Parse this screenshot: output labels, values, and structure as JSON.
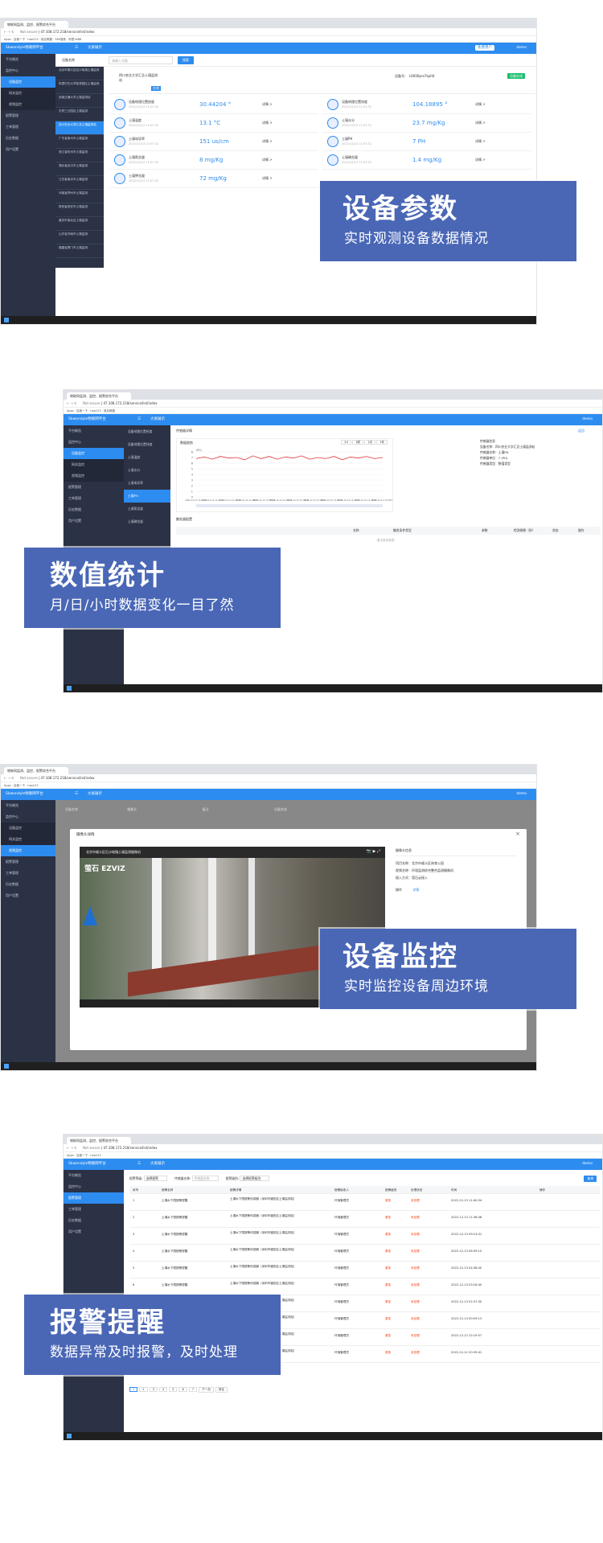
{
  "browser": {
    "url": "47.108.172.218/service/list/index",
    "not_secure": "Not secure",
    "tab_title": "物联网监测、监控、报警综合平台",
    "bookmarks": [
      "Apps",
      "百度一下",
      "hao123",
      "用友畅捷",
      "360搜索",
      "阿里1688",
      "京东商城",
      "Win7系统",
      "Win7系统",
      "搜狐视频",
      "微博网",
      "其他"
    ]
  },
  "app": {
    "logo": "Skwendyle物联网平台",
    "menu_title": "大屏展示",
    "user": "demo",
    "badge": "免费用户"
  },
  "sidebar": {
    "items": [
      {
        "label": "平台概览"
      },
      {
        "label": "监控中心"
      },
      {
        "label": "设备监控"
      },
      {
        "label": "网关监控"
      },
      {
        "label": "视频监控"
      },
      {
        "label": "报警管理"
      },
      {
        "label": "工单管理"
      },
      {
        "label": "历史数据"
      },
      {
        "label": "用户设置"
      }
    ]
  },
  "panel1": {
    "search_label": "设备名称",
    "search_placeholder": "请输入设备",
    "search_btn": "搜索",
    "devices": [
      "北京市顺义区后沙峪镇土壤监测",
      "阿里巴巴大学智慧园区土壤监测",
      "西南交通大学土壤监测站",
      "天府三元园区土壤监测",
      "四川农业大学汇总土壤监测站",
      "广东省惠州市土壤监测",
      "浙江省杭州市土壤监测",
      "湖北省武汉市土壤监测",
      "江苏省南京市土壤监测",
      "河南省郑州市土壤监测",
      "陕西省西安市土壤监测",
      "重庆市渝北区土壤监测",
      "山东省济南市土壤监测",
      "福建省厦门市土壤监测"
    ],
    "header": {
      "name": "四川农业大学汇总土壤监测站",
      "status": "在线",
      "serial_label": "设备号:",
      "serial": "L6000pro7kph6",
      "online_btn": "设备在线"
    },
    "metrics": [
      {
        "name": "设备地理位置经度",
        "time": "2022/12/13 11:07:32",
        "value": "30.44204 °",
        "more": "详情 >"
      },
      {
        "name": "设备地理位置纬度",
        "time": "2022/12/13 11:07:32",
        "value": "104.18895 °",
        "more": "详情 >"
      },
      {
        "name": "土壤温度",
        "time": "2022/12/13 11:07:32",
        "value": "13.1 °C",
        "more": "详情 >"
      },
      {
        "name": "土壤水分",
        "time": "2022/12/13 11:07:32",
        "value": "23.7 mg/Kg",
        "more": "详情 >"
      },
      {
        "name": "土壤电导率",
        "time": "2022/12/13 11:07:32",
        "value": "151 us/cm",
        "more": "详情 >"
      },
      {
        "name": "土壤PH",
        "time": "2022/12/13 11:07:32",
        "value": "7 PH",
        "more": "详情 >"
      },
      {
        "name": "土壤氮含量",
        "time": "2022/12/13 11:07:32",
        "value": "8 mg/Kg",
        "more": "详情 >"
      },
      {
        "name": "土壤磷含量",
        "time": "2022/12/13 11:07:32",
        "value": "1.4 mg/Kg",
        "more": "详情 >"
      },
      {
        "name": "土壤钾含量",
        "time": "2022/12/13 11:07:32",
        "value": "72 mg/Kg",
        "more": "详情 >"
      }
    ]
  },
  "panel2": {
    "title": "传感器详情",
    "back": "返回",
    "tabs": [
      "设备地理位置经度",
      "设备地理位置纬度",
      "土壤温度",
      "土壤水分",
      "土壤电导率",
      "土壤PH",
      "土壤氮含量",
      "土壤磷含量"
    ],
    "chart_title": "数据趋势",
    "ranges": [
      "24",
      "1周",
      "1月",
      "1年"
    ],
    "info_title": "传感器信息",
    "info": [
      "设备名称：四川农业大学汇总土壤监测站",
      "传感器名称：土壤PH",
      "传感器单位：7 (PH)",
      "传感器类型：数值类型"
    ],
    "section2": "触发器配置",
    "cols": [
      "名称",
      "触发条件类型",
      "参数",
      "检测周期（秒）",
      "状态",
      "操作"
    ],
    "empty": "暂无更多数据"
  },
  "chart_data": {
    "type": "line",
    "ylabel": "(PH)",
    "ylim": [
      0,
      8
    ],
    "yticks": [
      "0",
      "1",
      "2",
      "3",
      "4",
      "5",
      "6",
      "7",
      "8"
    ],
    "x": [
      "2022-12-13 11:07:32",
      "2022-12-13 11:17:31",
      "2022-12-13 11:37:32",
      "2022-12-13 11:48:27",
      "2022-12-13 12:07:31",
      "2022-12-13 12:17:31",
      "2022-12-13 12:37:32",
      "2022-12-13 12:48:27",
      "2022-12-13 13:07:31",
      "2022-12-13 13:17:31",
      "2022-12-13 13:37:32",
      "2022-12-13 13:48:27"
    ],
    "series": [
      {
        "values": [
          6.8,
          7.1,
          6.7,
          7.2,
          6.9,
          7.0,
          6.6,
          7.3,
          6.8,
          7.2,
          6.7,
          7.1,
          6.9,
          7.3,
          6.7,
          7.0,
          6.8,
          7.2,
          6.6,
          7.1,
          6.9,
          7.2,
          6.8,
          7.0
        ]
      }
    ]
  },
  "panel3": {
    "filters": [
      "设备名称",
      "摄像头",
      "备注",
      "设备状态"
    ],
    "modal_title": "摄像头详情",
    "video_title": "北京市顺义区后沙峪镇土壤监测摄像机",
    "brand": "萤石 EZVIZ",
    "info_title": "摄像头信息",
    "info": [
      "项目名称：北京市顺义区体育公园",
      "视频名称：环境监测综合整合监测摄像机",
      "接入方式：萤石云接入"
    ],
    "op_label": "操作",
    "op_link": "详情"
  },
  "panel4": {
    "filters": [
      {
        "label": "报警等级:",
        "value": "选择报警"
      },
      {
        "label": "传感器名称:",
        "value": "传感器名称"
      },
      {
        "label": "报警级别:",
        "value": "选择报警级别"
      }
    ],
    "search_btn": "查询",
    "cols": [
      "序号",
      "报警名称",
      "报警详情",
      "报警接收人",
      "报警级别",
      "处理状态",
      "时间",
      "操作"
    ],
    "rows": [
      [
        "1",
        "土壤水下限报警提醒",
        "土壤水下限报警传感器（深圳市福田区土壤监测站）",
        "环境管理员",
        "紧急",
        "未处理",
        "2022-12-13 11:40:34"
      ],
      [
        "2",
        "土壤水下限报警提醒",
        "土壤水下限报警传感器（深圳市福田区土壤监测站）",
        "环境管理员",
        "紧急",
        "未处理",
        "2022-12-13 11:38:48"
      ],
      [
        "3",
        "土壤水下限报警提醒",
        "土壤水下限报警传感器（深圳市福田区土壤监测站）",
        "环境管理员",
        "紧急",
        "未处理",
        "2022-12-13 09:13:31"
      ],
      [
        "4",
        "土壤水下限报警提醒",
        "土壤水下限报警传感器（深圳市福田区土壤监测站）",
        "环境管理员",
        "紧急",
        "未处理",
        "2022-12-13 06:39:10"
      ],
      [
        "5",
        "土壤水下限报警提醒",
        "土壤水下限报警传感器（深圳市福田区土壤监测站）",
        "环境管理员",
        "紧急",
        "未处理",
        "2022-12-13 04:38:40"
      ],
      [
        "6",
        "土壤水下限报警提醒",
        "土壤水下限报警传感器（深圳市福田区土壤监测站）",
        "环境管理员",
        "紧急",
        "未处理",
        "2022-12-13 03:18:40"
      ],
      [
        "7",
        "土壤水下限报警提醒",
        "土壤水下限报警传感器（深圳市福田区土壤监测站）",
        "环境管理员",
        "紧急",
        "未处理",
        "2022-12-13 02:37:30"
      ],
      [
        "8",
        "土壤水下限报警提醒",
        "土壤水下限报警传感器（深圳市福田区土壤监测站）",
        "环境管理员",
        "紧急",
        "未处理",
        "2022-12-13 00:59:13"
      ],
      [
        "9",
        "土壤水下限报警提醒",
        "土壤水下限报警传感器（深圳市福田区土壤监测站）",
        "环境管理员",
        "紧急",
        "未处理",
        "2022-12-12 22:19:57"
      ],
      [
        "10",
        "土壤水下限报警提醒",
        "土壤水下限报警传感器（深圳市福田区土壤监测站）",
        "环境管理员",
        "紧急",
        "未处理",
        "2022-12-12 20:39:41"
      ]
    ],
    "pager": [
      "1",
      "2",
      "3",
      "4",
      "5",
      "6",
      "7"
    ],
    "pager_next": "下一页",
    "pager_go": "前往"
  },
  "callouts": [
    {
      "title": "设备参数",
      "sub": "实时观测设备数据情况"
    },
    {
      "title": "数值统计",
      "sub": "月/日/小时数据变化一目了然"
    },
    {
      "title": "设备监控",
      "sub": "实时监控设备周边环境"
    },
    {
      "title": "报警提醒",
      "sub": "数据异常及时报警，及时处理"
    }
  ],
  "colors": {
    "accent": "#2d8cf0",
    "sidebar": "#2b3245",
    "callout": "#4a67b6",
    "alarm": "#ed4014"
  }
}
